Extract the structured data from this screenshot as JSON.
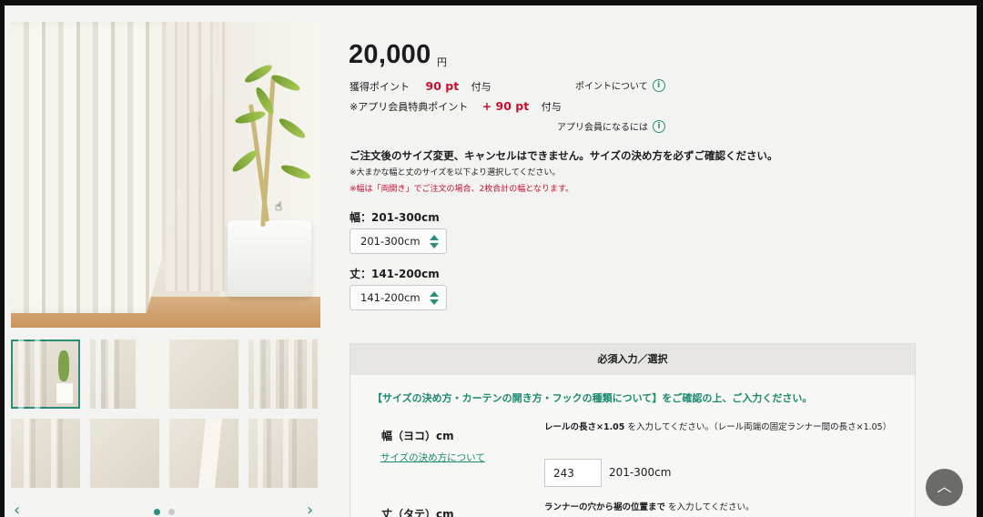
{
  "product": {
    "price": "20,000",
    "price_unit": "円",
    "points_label": "獲得ポイント",
    "points_value": "90 pt",
    "points_suffix": "付与",
    "app_points_label": "※アプリ会員特典ポイント",
    "app_points_value": "+ 90 pt",
    "app_points_suffix": "付与",
    "points_info_link": "ポイントについて",
    "app_member_link": "アプリ会員になるには",
    "notice_bold": "ご注文後のサイズ変更、キャンセルはできません。サイズの決め方を必ずご確認ください。",
    "note_1": "※大まかな幅と丈のサイズを以下より選択してください。",
    "note_2": "※幅は「両開き」でご注文の場合、2枚合計の幅となります。"
  },
  "selectors": {
    "width_label": "幅：201-300cm",
    "width_value": "201-300cm",
    "length_label": "丈：141-200cm",
    "length_value": "141-200cm"
  },
  "required_panel": {
    "header": "必須入力／選択",
    "guide_link": "【サイズの決め方・カーテンの開き方・フックの種類について】をご確認の上、ご入力ください。",
    "width_row_label": "幅（ヨコ）cm",
    "size_howto_link": "サイズの決め方について",
    "width_instr_bold": "レールの長さ×1.05",
    "width_instr_rest": "を入力してください。（レール両端の固定ランナー間の長さ×1.05）",
    "width_input_value": "243",
    "width_range": "201-300cm",
    "length_row_label": "丈（タテ）cm",
    "length_instr_bold": "ランナーの穴から裾の位置まで",
    "length_instr_rest": "を入力してください。"
  },
  "gallery": {
    "thumbnail_count": 8,
    "active_thumbnail": 1,
    "page_dots": 2,
    "active_page": 1
  },
  "colors": {
    "accent": "#2a8f7a",
    "price_red": "#c8102e",
    "link_green": "#1a8a6f"
  },
  "icons": [
    "info-icon",
    "stepper-icon",
    "chevron-left-icon",
    "chevron-right-icon",
    "chevron-up-icon",
    "cursor-icon"
  ]
}
